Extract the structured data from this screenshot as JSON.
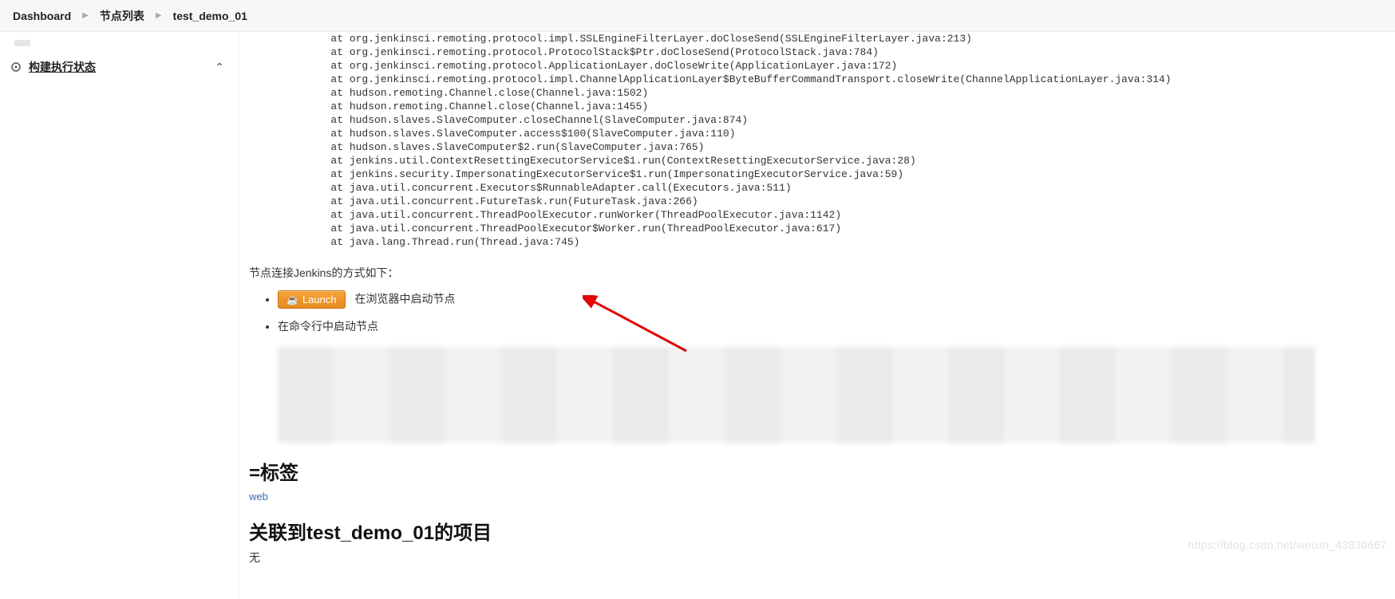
{
  "breadcrumb": {
    "dashboard": "Dashboard",
    "nodes": "节点列表",
    "current": "test_demo_01"
  },
  "sidebar": {
    "build_status": "构建执行状态"
  },
  "stack_trace": "\tat org.jenkinsci.remoting.protocol.impl.SSLEngineFilterLayer.doCloseSend(SSLEngineFilterLayer.java:213)\n\tat org.jenkinsci.remoting.protocol.ProtocolStack$Ptr.doCloseSend(ProtocolStack.java:784)\n\tat org.jenkinsci.remoting.protocol.ApplicationLayer.doCloseWrite(ApplicationLayer.java:172)\n\tat org.jenkinsci.remoting.protocol.impl.ChannelApplicationLayer$ByteBufferCommandTransport.closeWrite(ChannelApplicationLayer.java:314)\n\tat hudson.remoting.Channel.close(Channel.java:1502)\n\tat hudson.remoting.Channel.close(Channel.java:1455)\n\tat hudson.slaves.SlaveComputer.closeChannel(SlaveComputer.java:874)\n\tat hudson.slaves.SlaveComputer.access$100(SlaveComputer.java:110)\n\tat hudson.slaves.SlaveComputer$2.run(SlaveComputer.java:765)\n\tat jenkins.util.ContextResettingExecutorService$1.run(ContextResettingExecutorService.java:28)\n\tat jenkins.security.ImpersonatingExecutorService$1.run(ImpersonatingExecutorService.java:59)\n\tat java.util.concurrent.Executors$RunnableAdapter.call(Executors.java:511)\n\tat java.util.concurrent.FutureTask.run(FutureTask.java:266)\n\tat java.util.concurrent.ThreadPoolExecutor.runWorker(ThreadPoolExecutor.java:1142)\n\tat java.util.concurrent.ThreadPoolExecutor$Worker.run(ThreadPoolExecutor.java:617)\n\tat java.lang.Thread.run(Thread.java:745)",
  "connect": {
    "intro": "节点连接Jenkins的方式如下：",
    "launch_label": "Launch",
    "browser_text": "在浏览器中启动节点",
    "cli_text": "在命令行中启动节点"
  },
  "sections": {
    "tags_heading": "=标签",
    "tag_link": "web",
    "projects_heading": "关联到test_demo_01的项目",
    "none": "无"
  },
  "watermark": "https://blog.csdn.net/weixin_43930667"
}
